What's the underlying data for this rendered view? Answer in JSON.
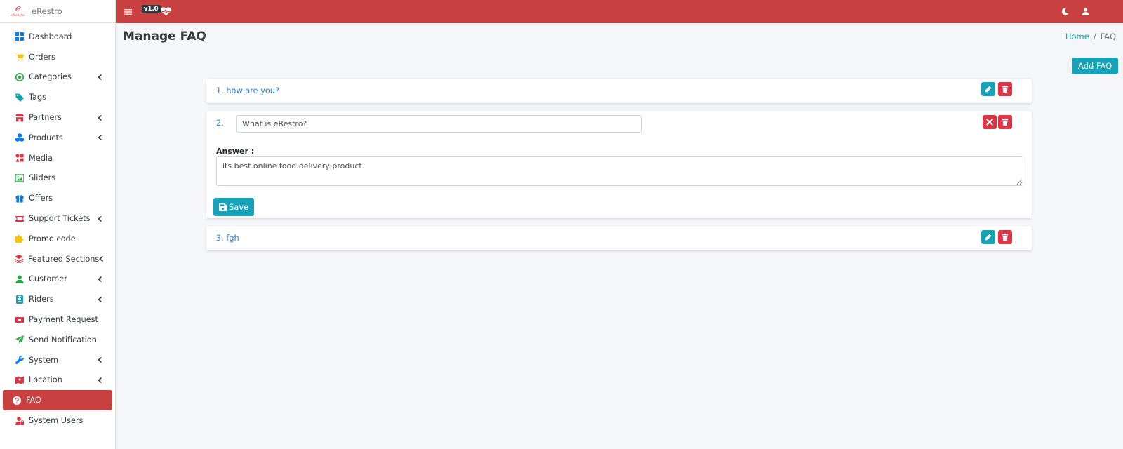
{
  "brand": {
    "logo_text": "eRestro",
    "name": "eRestro"
  },
  "topbar": {
    "version": "v1.0"
  },
  "sidebar": {
    "items": [
      {
        "label": "Dashboard",
        "icon": "dashboard-icon",
        "color": "#007bff",
        "chevron": false
      },
      {
        "label": "Orders",
        "icon": "cart-icon",
        "color": "#ffc107",
        "chevron": false
      },
      {
        "label": "Categories",
        "icon": "target-icon",
        "color": "#28a745",
        "chevron": true
      },
      {
        "label": "Tags",
        "icon": "tag-icon",
        "color": "#17a2b8",
        "chevron": false
      },
      {
        "label": "Partners",
        "icon": "store-icon",
        "color": "#dc3545",
        "chevron": true
      },
      {
        "label": "Products",
        "icon": "cubes-icon",
        "color": "#007bff",
        "chevron": true
      },
      {
        "label": "Media",
        "icon": "media-icon",
        "color": "#dc3545",
        "chevron": false
      },
      {
        "label": "Sliders",
        "icon": "image-icon",
        "color": "#28a745",
        "chevron": false
      },
      {
        "label": "Offers",
        "icon": "gift-icon",
        "color": "#007bff",
        "chevron": false
      },
      {
        "label": "Support Tickets",
        "icon": "ticket-icon",
        "color": "#dc3545",
        "chevron": true
      },
      {
        "label": "Promo code",
        "icon": "puzzle-icon",
        "color": "#ffc107",
        "chevron": false
      },
      {
        "label": "Featured Sections",
        "icon": "layers-icon",
        "color": "#dc3545",
        "chevron": true
      },
      {
        "label": "Customer",
        "icon": "user-icon",
        "color": "#28a745",
        "chevron": true
      },
      {
        "label": "Riders",
        "icon": "id-badge-icon",
        "color": "#17a2b8",
        "chevron": true
      },
      {
        "label": "Payment Request",
        "icon": "money-icon",
        "color": "#dc3545",
        "chevron": false
      },
      {
        "label": "Send Notification",
        "icon": "paper-plane-icon",
        "color": "#28a745",
        "chevron": false
      },
      {
        "label": "System",
        "icon": "wrench-icon",
        "color": "#007bff",
        "chevron": true
      },
      {
        "label": "Location",
        "icon": "map-icon",
        "color": "#dc3545",
        "chevron": true
      },
      {
        "label": "FAQ",
        "icon": "question-circle-icon",
        "color": "#ffffff",
        "chevron": false,
        "active": true
      },
      {
        "label": "System Users",
        "icon": "user-lock-icon",
        "color": "#dc3545",
        "chevron": false
      }
    ]
  },
  "page": {
    "title": "Manage FAQ"
  },
  "breadcrumb": {
    "home": "Home",
    "separator": "/",
    "current": "FAQ"
  },
  "actions": {
    "add_faq": "Add FAQ"
  },
  "faqs": [
    {
      "label": "1. how are you?"
    },
    {
      "number": "2.",
      "question_value": "What is eRestro?",
      "answer_label": "Answer :",
      "answer_value": "its best online food delivery product",
      "save_label": "Save"
    },
    {
      "label": "3. fgh"
    }
  ],
  "colors": {
    "brand": "#c94040",
    "info": "#17a2b8",
    "danger": "#dc3545",
    "link": "#2f7bd6"
  }
}
